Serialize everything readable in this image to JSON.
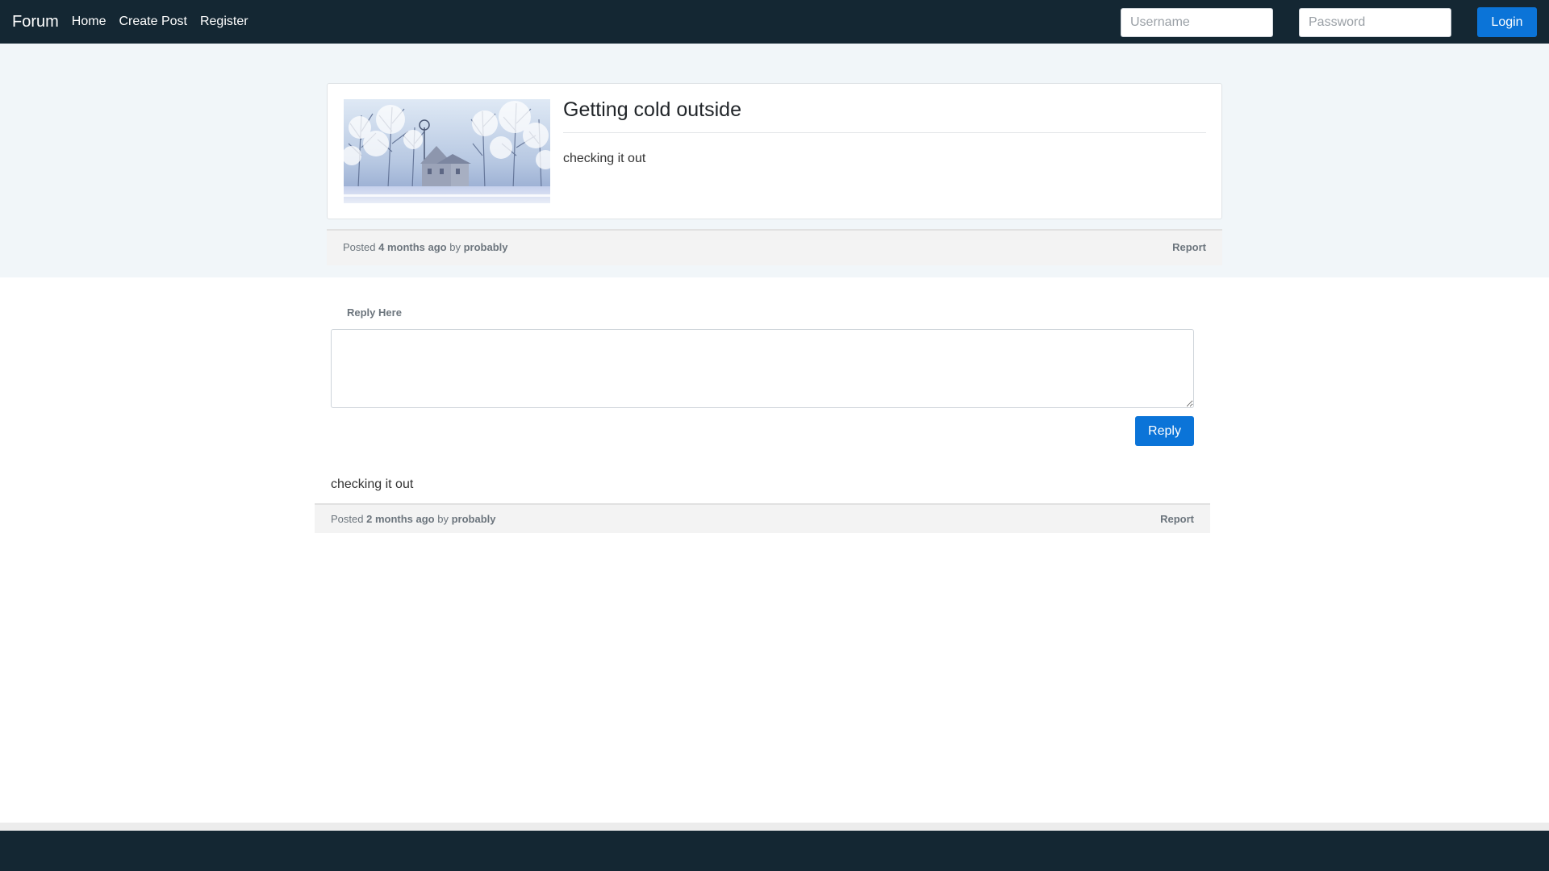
{
  "navbar": {
    "brand": "Forum",
    "links": [
      "Home",
      "Create Post",
      "Register"
    ],
    "username_placeholder": "Username",
    "password_placeholder": "Password",
    "login_label": "Login"
  },
  "post": {
    "title": "Getting cold outside",
    "body": "checking it out",
    "meta": {
      "posted": "Posted",
      "time": "4 months ago",
      "by": "by",
      "author": "probably",
      "report": "Report"
    }
  },
  "reply": {
    "label": "Reply Here",
    "button": "Reply"
  },
  "comment": {
    "body": "checking it out",
    "meta": {
      "posted": "Posted",
      "time": "2 months ago",
      "by": "by",
      "author": "probably",
      "report": "Report"
    }
  },
  "colors": {
    "navbar": "#142733",
    "accent": "#0b74d8",
    "post_section_bg": "#f1f6f9"
  }
}
